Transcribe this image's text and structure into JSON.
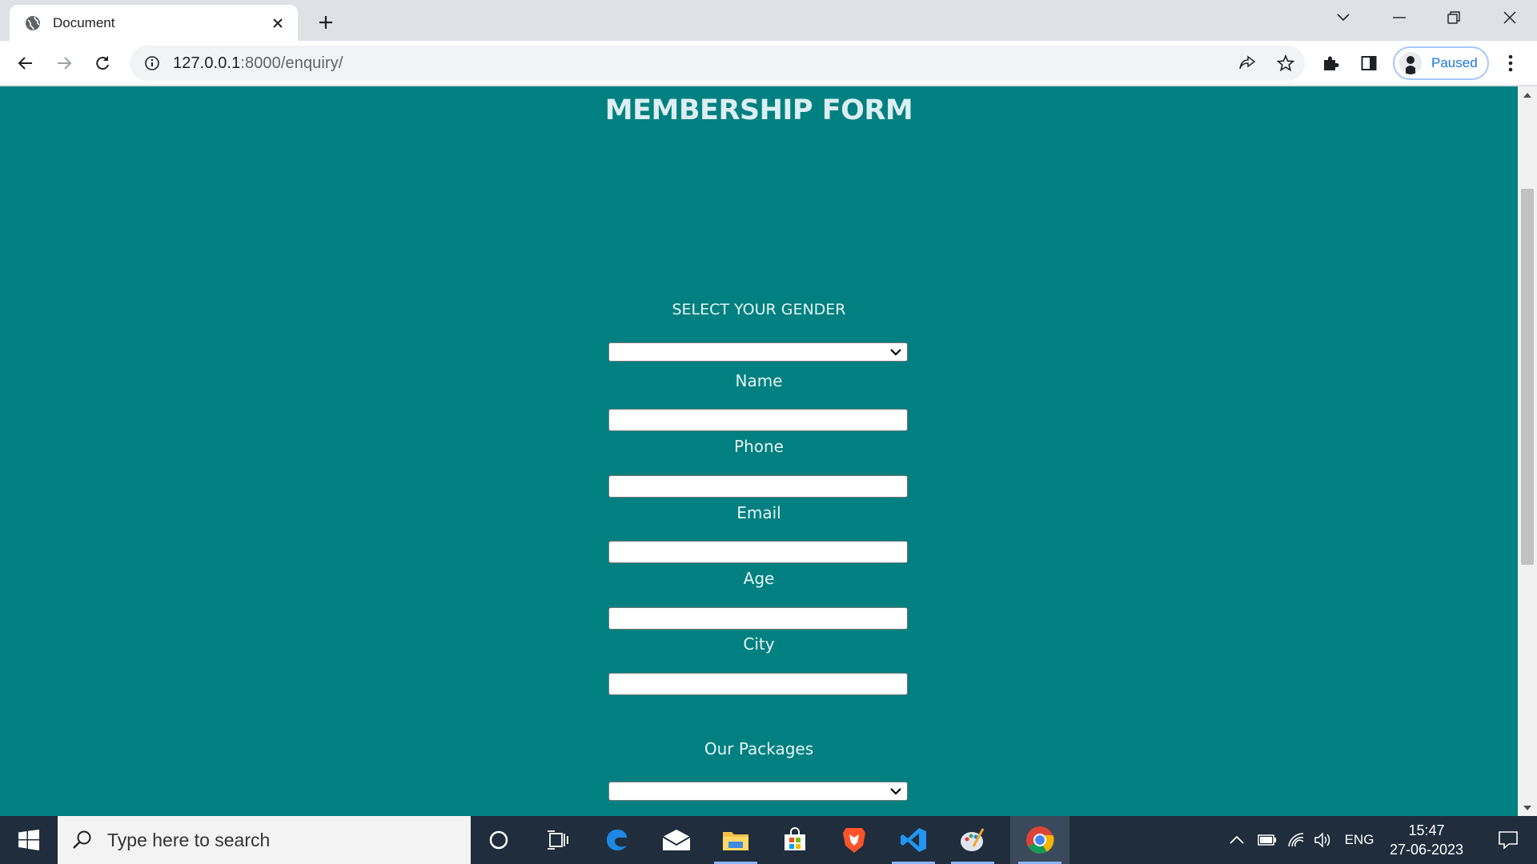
{
  "browser": {
    "tab": {
      "title": "Document",
      "favicon": "globe-icon"
    },
    "url": {
      "host": "127.0.0.1",
      "path": ":8000/enquiry/"
    },
    "profile": {
      "label": "Paused"
    }
  },
  "page": {
    "title": "MEMBERSHIP FORM",
    "form": {
      "gender_label": "SELECT YOUR GENDER",
      "gender_value": "",
      "name_label": "Name",
      "name_value": "",
      "phone_label": "Phone",
      "phone_value": "",
      "email_label": "Email",
      "email_value": "",
      "age_label": "Age",
      "age_value": "",
      "city_label": "City",
      "city_value": "",
      "packages_label": "Our Packages",
      "packages_value": ""
    }
  },
  "taskbar": {
    "search_placeholder": "Type here to search",
    "language": "ENG",
    "time": "15:47",
    "date": "27-06-2023"
  },
  "colors": {
    "page_background": "#008080",
    "title_color": "#ddeef2",
    "taskbar": "#1f2d3d"
  }
}
